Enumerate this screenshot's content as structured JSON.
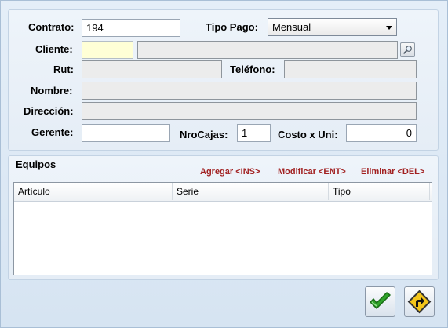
{
  "form": {
    "contrato_label": "Contrato:",
    "contrato_value": "194",
    "tipo_pago_label": "Tipo Pago:",
    "tipo_pago_value": "Mensual",
    "cliente_label": "Cliente:",
    "cliente_code": "",
    "cliente_name": "",
    "rut_label": "Rut:",
    "rut_value": "",
    "telefono_label": "Teléfono:",
    "telefono_value": "",
    "nombre_label": "Nombre:",
    "nombre_value": "",
    "direccion_label": "Dirección:",
    "direccion_value": "",
    "gerente_label": "Gerente:",
    "gerente_value": "",
    "nrocajas_label": "NroCajas:",
    "nrocajas_value": "1",
    "costo_label": "Costo x Uni:",
    "costo_value": "0"
  },
  "equipos": {
    "title": "Equipos",
    "add_label": "Agregar <INS>",
    "edit_label": "Modificar <ENT>",
    "delete_label": "Eliminar <DEL>",
    "columns": [
      "Artículo",
      "Serie",
      "Tipo"
    ],
    "rows": []
  },
  "icons": {
    "lookup": "magnifier-icon",
    "accept": "checkmark-icon",
    "cancel": "return-arrow-icon"
  },
  "colors": {
    "link": "#a12020",
    "accept_green": "#2fa32a",
    "cancel_yellow": "#f3c51a"
  }
}
